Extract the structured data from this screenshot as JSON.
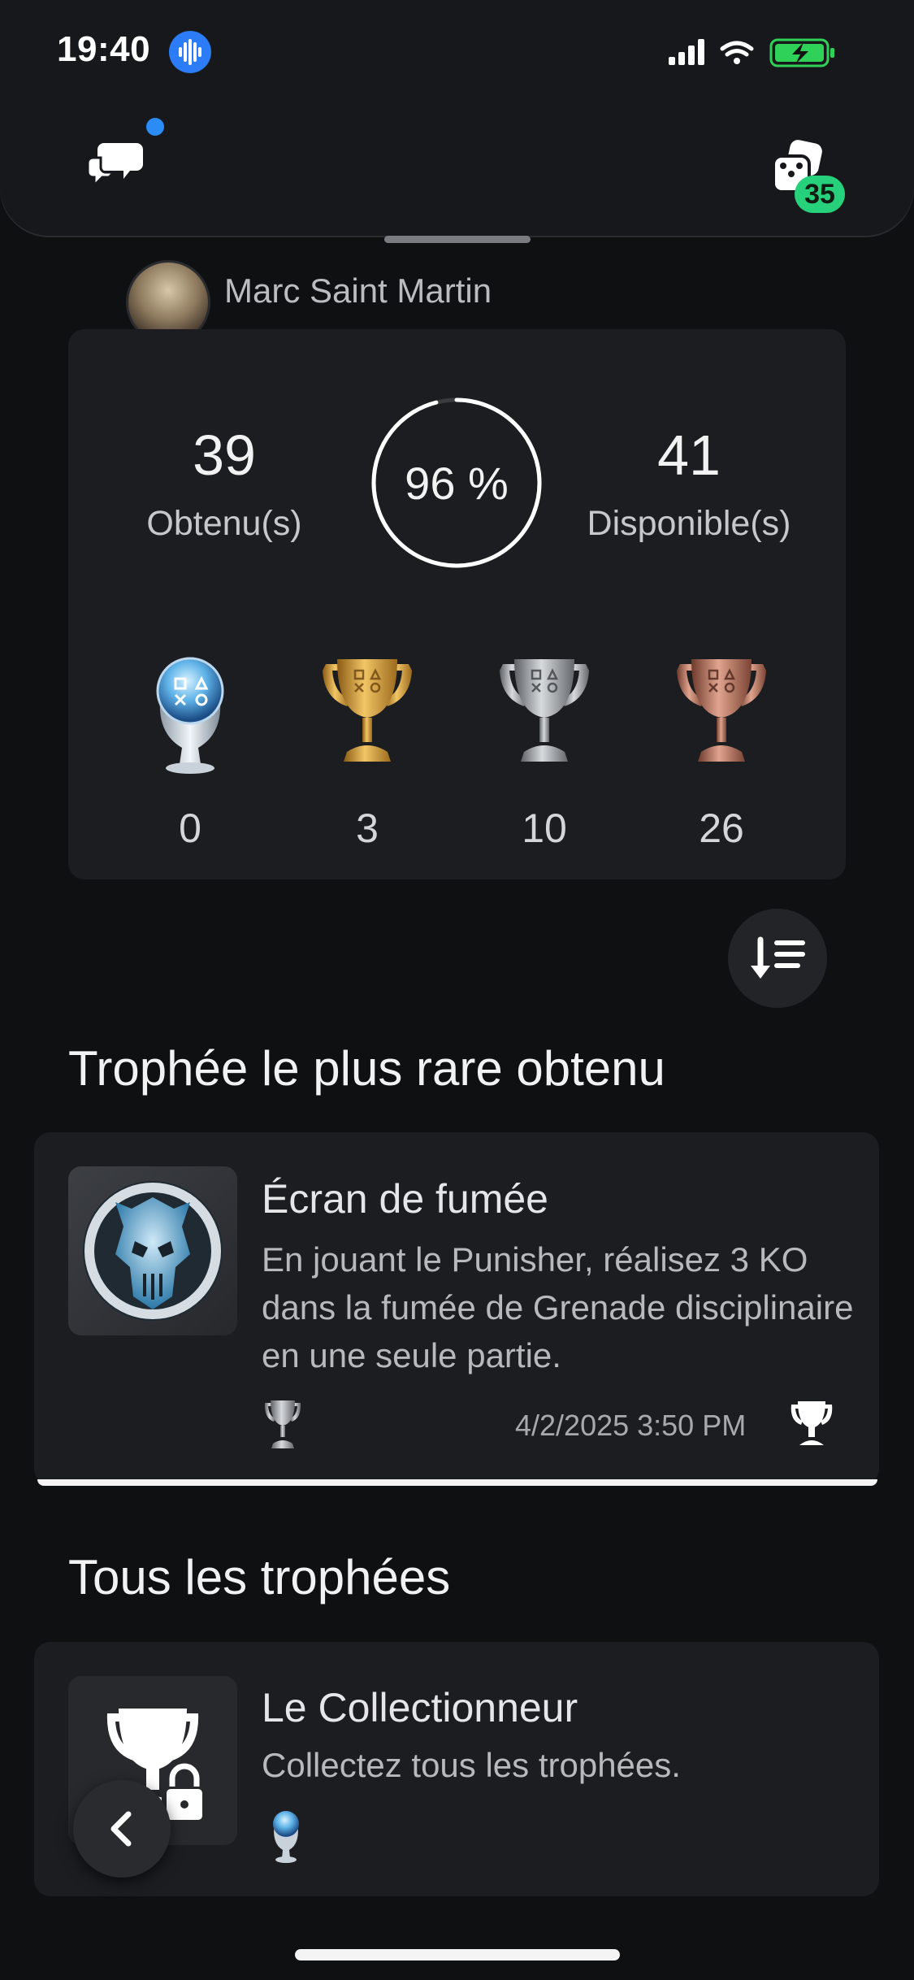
{
  "status": {
    "time": "19:40"
  },
  "header": {
    "badge_count": "35"
  },
  "profile": {
    "name": "Marc Saint Martin"
  },
  "summary": {
    "earned_value": "39",
    "earned_label": "Obtenu(s)",
    "progress_text": "96 %",
    "progress_value": 0.96,
    "available_value": "41",
    "available_label": "Disponible(s)",
    "trophies": [
      {
        "grade": "platinum",
        "count": "0"
      },
      {
        "grade": "gold",
        "count": "3"
      },
      {
        "grade": "silver",
        "count": "10"
      },
      {
        "grade": "bronze",
        "count": "26"
      }
    ]
  },
  "rare_section": {
    "title": "Trophée le plus rare obtenu",
    "trophy": {
      "name": "Écran de fumée",
      "description": "En jouant le Punisher, réalisez 3 KO dans la fumée de Grenade disciplinaire en une seule partie.",
      "grade": "silver",
      "date": "4/2/2025  3:50 PM"
    }
  },
  "all_section": {
    "title": "Tous les trophées",
    "trophy": {
      "name": "Le Collectionneur",
      "description": "Collectez tous les trophées.",
      "grade": "platinum"
    }
  },
  "colors": {
    "background": "#0f1012",
    "card": "#1c1d20",
    "badge": "#27d07a",
    "notification_dot": "#2b8cf6",
    "battery": "#30d158"
  }
}
